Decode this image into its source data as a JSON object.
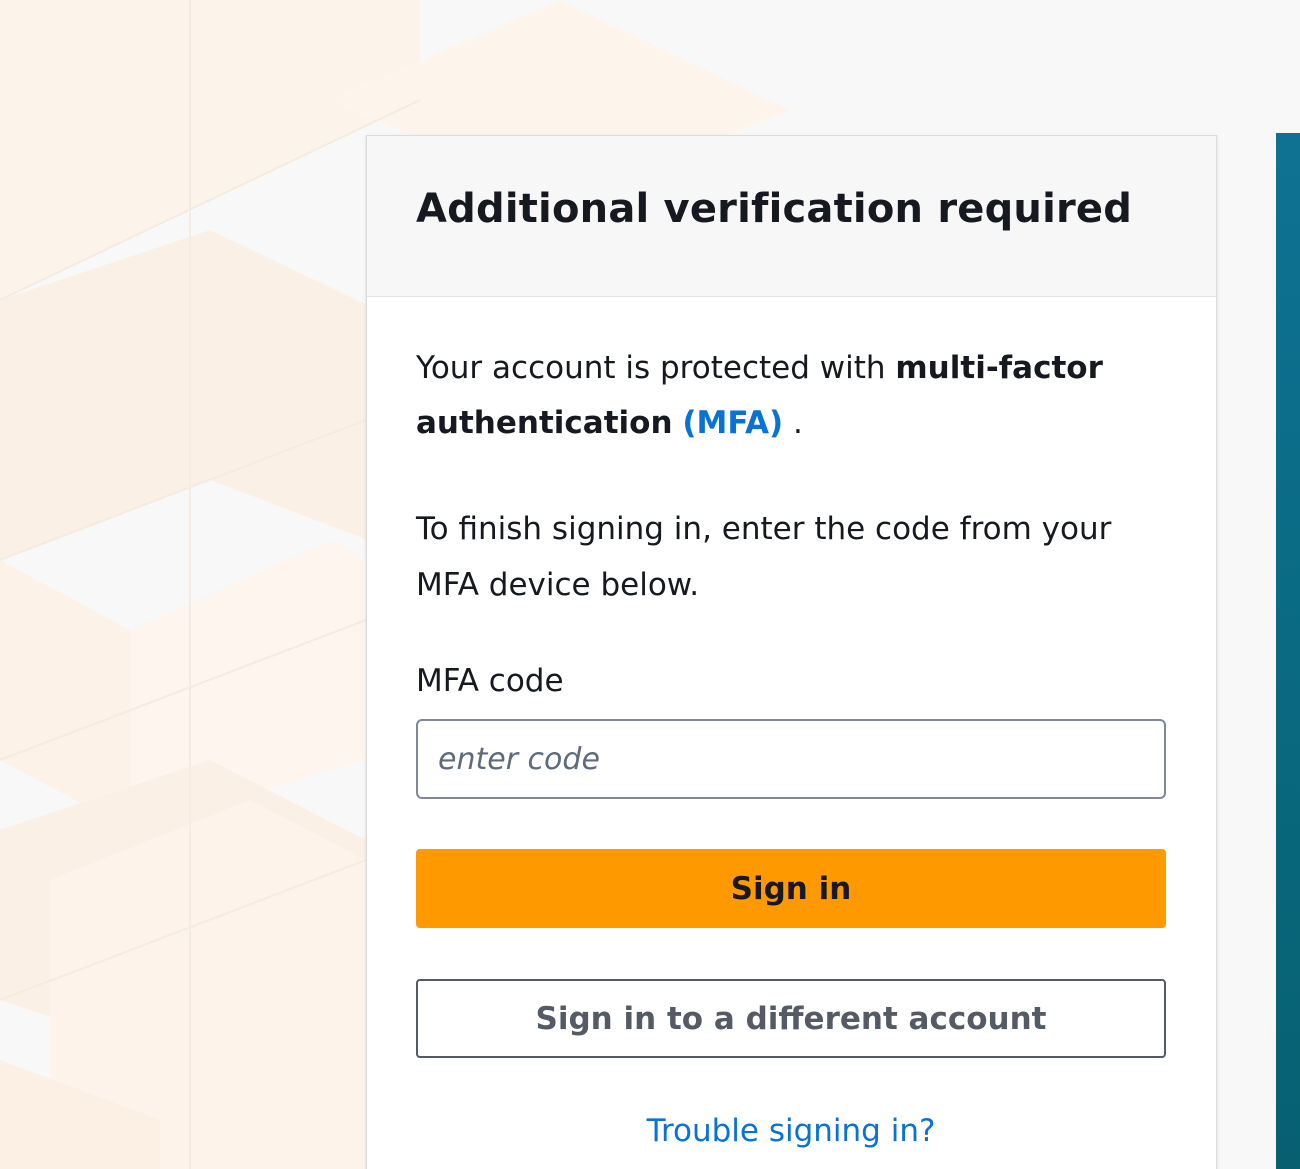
{
  "card": {
    "title": "Additional verification required",
    "intro_prefix": "Your account is protected with ",
    "intro_bold": "multi-factor authentication",
    "intro_link": "(MFA)",
    "intro_suffix": " .",
    "instructions": "To finish signing in, enter the code from your MFA device below."
  },
  "form": {
    "code_label": "MFA code",
    "code_placeholder": "enter code",
    "sign_in_label": "Sign in",
    "different_account_label": "Sign in to a different account",
    "trouble_label": "Trouble signing in?"
  },
  "colors": {
    "primary_button": "#ff9900",
    "link": "#0972d3",
    "side_panel": "#0a6a82"
  }
}
